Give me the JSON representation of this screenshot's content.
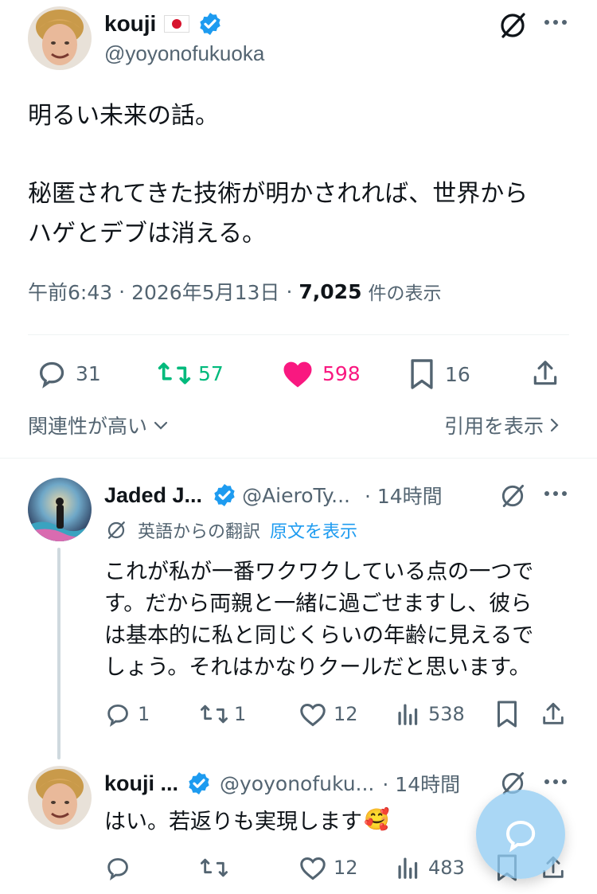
{
  "main_tweet": {
    "display_name": "kouji",
    "flag": "jp-flag",
    "handle": "@yoyonofukuoka",
    "text_line1": "明るい未来の話。",
    "text_line2": "秘匿されてきた技術が明かされれば、世界から",
    "text_line3": "ハゲとデブは消える。",
    "time": "午前6:43",
    "date": "2026年5月13日",
    "views_count": "7,025",
    "views_label": "件の表示",
    "sep": "·",
    "replies": "31",
    "retweets": "57",
    "likes": "598",
    "bookmarks": "16",
    "colors": {
      "retweet": "#00ba7c",
      "like": "#f91880",
      "link": "#1d9bf0"
    }
  },
  "sort": {
    "label": "関連性が高い",
    "quotes_label": "引用を表示"
  },
  "reply1": {
    "display_name": "Jaded J...",
    "handle": "@AieroTy...",
    "time": "· 14時間",
    "translated_from": "英語からの翻訳",
    "show_original": "原文を表示",
    "line1": "これが私が一番ワクワクしている点の一つで",
    "line2": "す。だから両親と一緒に過ごせますし、彼ら",
    "line3": "は基本的に私と同じくらいの年齢に見えるで",
    "line4": "しょう。それはかなりクールだと思います。",
    "replies": "1",
    "retweets": "1",
    "likes": "12",
    "views": "538"
  },
  "reply2": {
    "display_name": "kouji ...",
    "handle": "@yoyonofuku...",
    "time": "· 14時間",
    "text": "はい。若返りも実現します",
    "emoji": "🥰",
    "likes": "12",
    "views": "483"
  },
  "icons": [
    "verified-badge-icon",
    "grok-icon",
    "more-icon",
    "reply-icon",
    "retweet-icon",
    "heart-icon",
    "bookmark-icon",
    "share-icon",
    "chevron-down-icon",
    "chevron-right-icon",
    "views-icon",
    "translate-icon",
    "compose-reply-icon"
  ]
}
